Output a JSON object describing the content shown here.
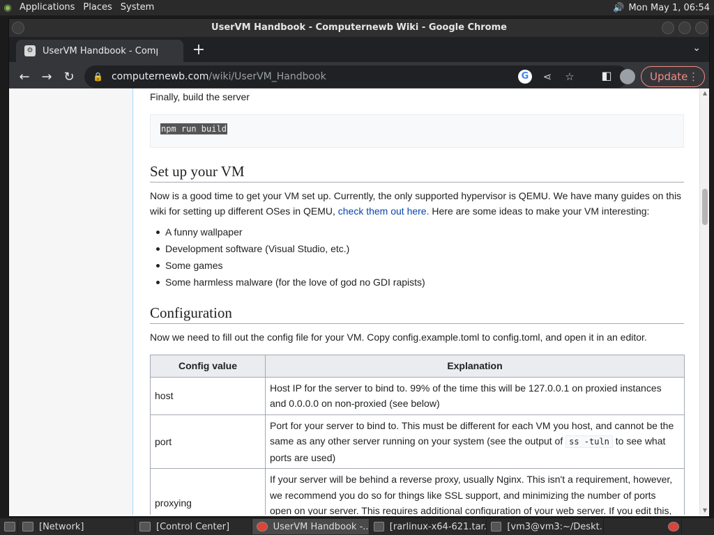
{
  "panel": {
    "menus": [
      "Applications",
      "Places",
      "System"
    ],
    "clock": "Mon May  1, 06:54"
  },
  "window": {
    "title": "UserVM Handbook - Computernewb Wiki - Google Chrome"
  },
  "tab": {
    "title": "UserVM Handbook - Computernewb Wiki"
  },
  "omnibox": {
    "host": "computernewb.com",
    "path": "/wiki/UserVM_Handbook"
  },
  "toolbar": {
    "update_label": "Update"
  },
  "article": {
    "build_intro": "Finally, build the server",
    "build_code": "npm run build",
    "vm_heading": "Set up your VM",
    "vm_para_before": "Now is a good time to get your VM set up. Currently, the only supported hypervisor is QEMU. We have many guides on this wiki for setting up different OSes in QEMU, ",
    "vm_link": "check them out here.",
    "vm_para_after": " Here are some ideas to make your VM interesting:",
    "ideas": [
      "A funny wallpaper",
      "Development software (Visual Studio, etc.)",
      "Some games",
      "Some harmless malware (for the love of god no GDI rapists)"
    ],
    "config_heading": "Configuration",
    "config_para": "Now we need to fill out the config file for your VM. Copy config.example.toml to config.toml, and open it in an editor.",
    "table": {
      "headers": [
        "Config value",
        "Explanation"
      ],
      "rows": [
        {
          "key": "host",
          "text": "Host IP for the server to bind to. 99% of the time this will be 127.0.0.1 on proxied instances and 0.0.0.0 on non-proxied (see below)"
        },
        {
          "key": "port",
          "text_before": "Port for your server to bind to. This must be different for each VM you host, and cannot be the same as any other server running on your system (see the output of ",
          "code": "ss -tuln",
          "text_after": " to see what ports are used)"
        },
        {
          "key": "proxying",
          "text": "If your server will be behind a reverse proxy, usually Nginx. This isn't a requirement, however, we recommend you do so for things like SSL support, and minimizing the number of ports open on your server. This requires additional configuration of your web server. If you edit this, make sure to also set the proxyAllowedIps"
        }
      ]
    }
  },
  "taskbar": [
    {
      "label": "[Network]",
      "active": false
    },
    {
      "label": "[Control Center]",
      "active": false
    },
    {
      "label": "UserVM Handbook -...",
      "active": true
    },
    {
      "label": "[rarlinux-x64-621.tar....",
      "active": false
    },
    {
      "label": "[vm3@vm3:~/Deskt...",
      "active": false
    }
  ]
}
